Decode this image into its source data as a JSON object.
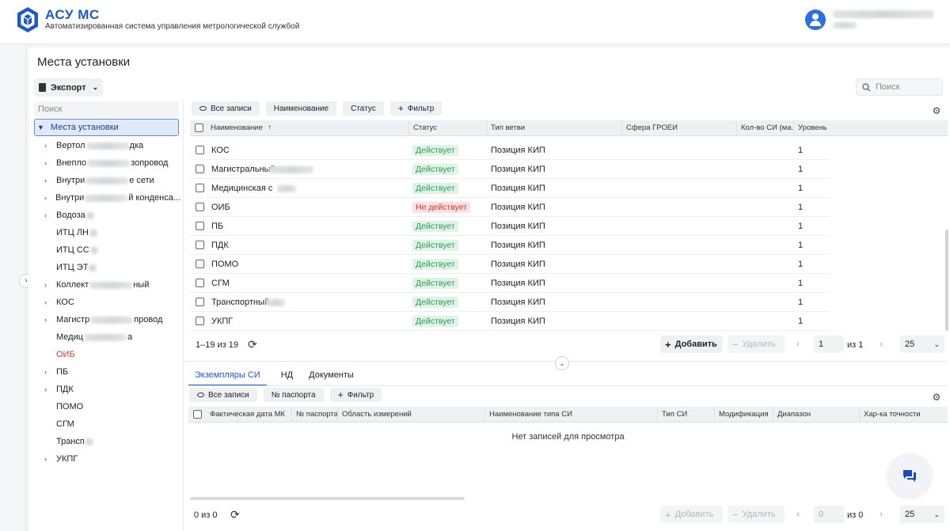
{
  "app": {
    "title": "АСУ МС",
    "subtitle": "Автоматизированная система управления метрологической службой"
  },
  "page": {
    "title": "Места установки",
    "export_label": "Экспорт",
    "search_placeholder": "Поиск"
  },
  "tree": {
    "search_placeholder": "Поиск",
    "root": "Места установки",
    "items": [
      {
        "prefix": "Вертол",
        "suffix": "дка",
        "expandable": true,
        "status": "normal"
      },
      {
        "prefix": "Внепло",
        "suffix": "зопровод",
        "expandable": true,
        "status": "normal"
      },
      {
        "prefix": "Внутри",
        "suffix": "е сети",
        "expandable": true,
        "status": "normal"
      },
      {
        "prefix": "Внутри",
        "suffix": "й конденса...",
        "expandable": true,
        "status": "normal"
      },
      {
        "prefix": "Водоза",
        "suffix": "",
        "expandable": true,
        "status": "normal"
      },
      {
        "prefix": "ИТЦ ЛН",
        "suffix": "",
        "expandable": false,
        "status": "normal"
      },
      {
        "prefix": "ИТЦ СС",
        "suffix": "",
        "expandable": false,
        "status": "normal"
      },
      {
        "prefix": "ИТЦ ЭТ",
        "suffix": "",
        "expandable": false,
        "status": "normal"
      },
      {
        "prefix": "Коллект",
        "suffix": "ный",
        "expandable": true,
        "status": "normal"
      },
      {
        "prefix": "КОС",
        "suffix": "",
        "expandable": true,
        "status": "normal"
      },
      {
        "prefix": "Магистр",
        "suffix": "провод",
        "expandable": true,
        "status": "normal"
      },
      {
        "prefix": "Медиц",
        "suffix": "а",
        "expandable": false,
        "status": "normal"
      },
      {
        "prefix": "ОИБ",
        "suffix": "",
        "expandable": false,
        "status": "inactive"
      },
      {
        "prefix": "ПБ",
        "suffix": "",
        "expandable": true,
        "status": "normal"
      },
      {
        "prefix": "ПДК",
        "suffix": "",
        "expandable": true,
        "status": "normal"
      },
      {
        "prefix": "ПОМО",
        "suffix": "",
        "expandable": false,
        "status": "normal"
      },
      {
        "prefix": "СГМ",
        "suffix": "",
        "expandable": false,
        "status": "normal"
      },
      {
        "prefix": "Трансп",
        "suffix": "",
        "expandable": false,
        "status": "normal"
      },
      {
        "prefix": "УКПГ",
        "suffix": "",
        "expandable": true,
        "status": "normal"
      }
    ]
  },
  "top_filters": {
    "all_records": "Все записи",
    "chips": [
      "Наименование",
      "Статус"
    ],
    "add_filter": "Фильтр"
  },
  "top_table": {
    "columns": [
      "Наименование",
      "Статус",
      "Тип ветви",
      "Сфера ГРОЕИ",
      "Кол-во СИ (ма...",
      "Уровень"
    ],
    "sort_indicator": "↑",
    "rows": [
      {
        "name": "КОС",
        "status": "Действует",
        "active": true,
        "branch": "Позиция КИП",
        "level": "1"
      },
      {
        "name": "Магистральный",
        "status": "Действует",
        "active": true,
        "branch": "Позиция КИП",
        "level": "1"
      },
      {
        "name": "Медицинская с",
        "status": "Действует",
        "active": true,
        "branch": "Позиция КИП",
        "level": "1"
      },
      {
        "name": "ОИБ",
        "status": "Не действует",
        "active": false,
        "branch": "Позиция КИП",
        "level": "1"
      },
      {
        "name": "ПБ",
        "status": "Действует",
        "active": true,
        "branch": "Позиция КИП",
        "level": "1"
      },
      {
        "name": "ПДК",
        "status": "Действует",
        "active": true,
        "branch": "Позиция КИП",
        "level": "1"
      },
      {
        "name": "ПОМО",
        "status": "Действует",
        "active": true,
        "branch": "Позиция КИП",
        "level": "1"
      },
      {
        "name": "СГМ",
        "status": "Действует",
        "active": true,
        "branch": "Позиция КИП",
        "level": "1"
      },
      {
        "name": "Транспортный",
        "status": "Действует",
        "active": true,
        "branch": "Позиция КИП",
        "level": "1"
      },
      {
        "name": "УКПГ",
        "status": "Действует",
        "active": true,
        "branch": "Позиция КИП",
        "level": "1"
      }
    ],
    "pager": {
      "range": "1–19 из 19",
      "add": "Добавить",
      "delete": "Удалить",
      "page": "1",
      "of_pages": "из 1",
      "page_size": "25"
    }
  },
  "bottom": {
    "tabs": [
      "Экземпляры СИ",
      "НД",
      "Документы"
    ],
    "filters": {
      "all_records": "Все записи",
      "chips": [
        "№ паспорта"
      ],
      "add_filter": "Фильтр"
    },
    "columns": [
      "Фактическая дата МК",
      "№ паспорта",
      "Область измерений",
      "Наименование типа СИ",
      "Тип СИ",
      "Модификация",
      "Диапазон",
      "Хар-ка точности"
    ],
    "empty_message": "Нет записей для просмотра",
    "pager": {
      "range": "0 из 0",
      "add": "Добавить",
      "delete": "Удалить",
      "page": "0",
      "of_pages": "из 0",
      "page_size": "25"
    }
  },
  "colors": {
    "brand": "#1f58c7",
    "active_badge": "#2f9a5c",
    "inactive_badge": "#d33333",
    "inactive_tree_item": "#d43a3a"
  },
  "icons": [
    "logo-icon",
    "user-avatar-icon",
    "export-doc-icon",
    "search-icon",
    "eye-icon",
    "plus-icon",
    "gear-icon",
    "refresh-icon",
    "chevron-left-icon",
    "chevron-right-icon",
    "chevron-down-icon",
    "chat-icon"
  ]
}
